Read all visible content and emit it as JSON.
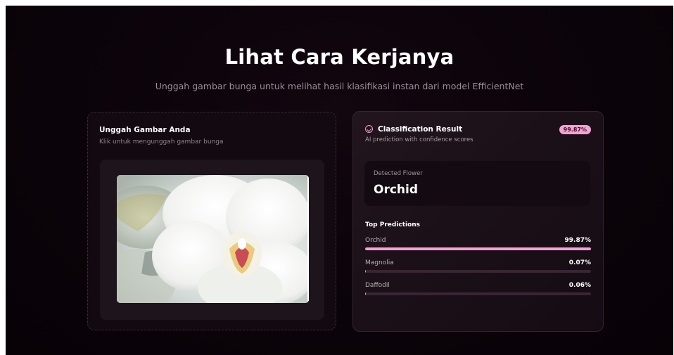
{
  "hero": {
    "title": "Lihat Cara Kerjanya",
    "subtitle": "Unggah gambar bunga untuk melihat hasil klasifikasi instan dari model EfficientNet"
  },
  "upload": {
    "title": "Unggah Gambar Anda",
    "description": "Klik untuk mengunggah gambar bunga",
    "preview_icon": "orchid-photo"
  },
  "result": {
    "icon": "check-circle-icon",
    "title": "Classification Result",
    "subtitle": "AI prediction with confidence scores",
    "confidence_badge": "99.87%",
    "detected_label": "Detected Flower",
    "detected_value": "Orchid",
    "top_predictions_title": "Top Predictions",
    "predictions": [
      {
        "name": "Orchid",
        "value": "99.87%",
        "fraction": 0.9987
      },
      {
        "name": "Magnolia",
        "value": "0.07%",
        "fraction": 0.0007
      },
      {
        "name": "Daffodil",
        "value": "0.06%",
        "fraction": 0.0006
      }
    ]
  },
  "colors": {
    "accent": "#f3a4d3",
    "track": "#3b2436",
    "background": "#0a0309"
  }
}
